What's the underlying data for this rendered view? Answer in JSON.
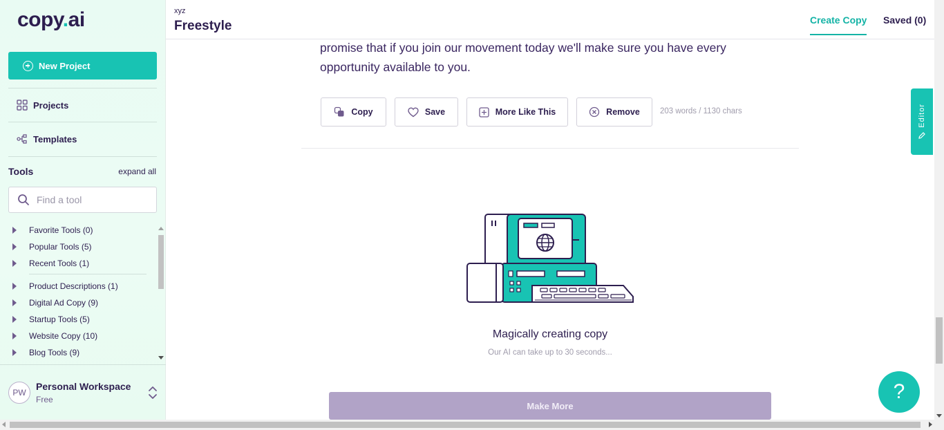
{
  "app": {
    "logo_text_a": "copy",
    "logo_dot": ".",
    "logo_text_b": "ai"
  },
  "sidebar": {
    "new_project": "New Project",
    "nav": [
      {
        "label": "Projects",
        "icon": "grid-icon"
      },
      {
        "label": "Templates",
        "icon": "templates-icon"
      }
    ],
    "tools_title": "Tools",
    "expand_all": "expand all",
    "search_placeholder": "Find a tool",
    "tools": [
      "Favorite Tools (0)",
      "Popular Tools (5)",
      "Recent Tools (1)",
      "Product Descriptions (1)",
      "Digital Ad Copy (9)",
      "Startup Tools (5)",
      "Website Copy (10)",
      "Blog Tools (9)"
    ],
    "workspace": {
      "initials": "PW",
      "name": "Personal Workspace",
      "plan": "Free"
    }
  },
  "header": {
    "project_sub": "xyz",
    "project_title": "Freestyle",
    "tab_create": "Create Copy",
    "tab_saved": "Saved (0)"
  },
  "main": {
    "output_text": "promise that if you join our movement today we'll make sure you have every opportunity available to you.",
    "actions": {
      "copy": "Copy",
      "save": "Save",
      "more_like_this": "More Like This",
      "remove": "Remove"
    },
    "counts": "203 words / 1130 chars",
    "loading_title": "Magically creating copy",
    "loading_sub": "Our AI can take up to 30 seconds...",
    "make_more": "Make More"
  },
  "editor_tab": "Editor",
  "help": "?",
  "colors": {
    "accent": "#18c3b3",
    "brand_text": "#2d1e4f",
    "disabled_button": "#b1a3c7"
  }
}
